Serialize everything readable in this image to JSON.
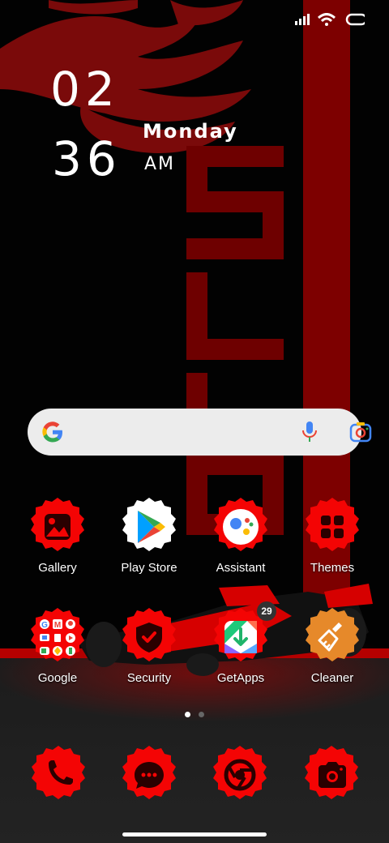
{
  "status_bar": {
    "icons": [
      "signal-icon",
      "wifi-icon",
      "battery-icon"
    ]
  },
  "clock": {
    "hour": "02",
    "minute": "36",
    "day": "Monday",
    "ampm": "AM"
  },
  "wallpaper": {
    "text": "SL",
    "accent_color": "#d10000"
  },
  "search": {
    "icons": [
      "google-logo-icon",
      "microphone-icon",
      "lens-camera-icon"
    ]
  },
  "apps": [
    {
      "label": "Gallery",
      "icon": "gallery-icon"
    },
    {
      "label": "Play Store",
      "icon": "play-store-icon"
    },
    {
      "label": "Assistant",
      "icon": "assistant-icon"
    },
    {
      "label": "Themes",
      "icon": "themes-icon"
    },
    {
      "label": "Google",
      "icon": "google-folder-icon"
    },
    {
      "label": "Security",
      "icon": "security-icon"
    },
    {
      "label": "GetApps",
      "icon": "getapps-icon",
      "badge": "29"
    },
    {
      "label": "Cleaner",
      "icon": "cleaner-icon"
    }
  ],
  "pages": {
    "count": 2,
    "active": 1
  },
  "dock": [
    {
      "icon": "phone-icon"
    },
    {
      "icon": "messages-icon"
    },
    {
      "icon": "chrome-icon"
    },
    {
      "icon": "camera-icon"
    }
  ],
  "colors": {
    "icon_red": "#f40404",
    "icon_dark": "#2a0000",
    "background": "#020202"
  }
}
